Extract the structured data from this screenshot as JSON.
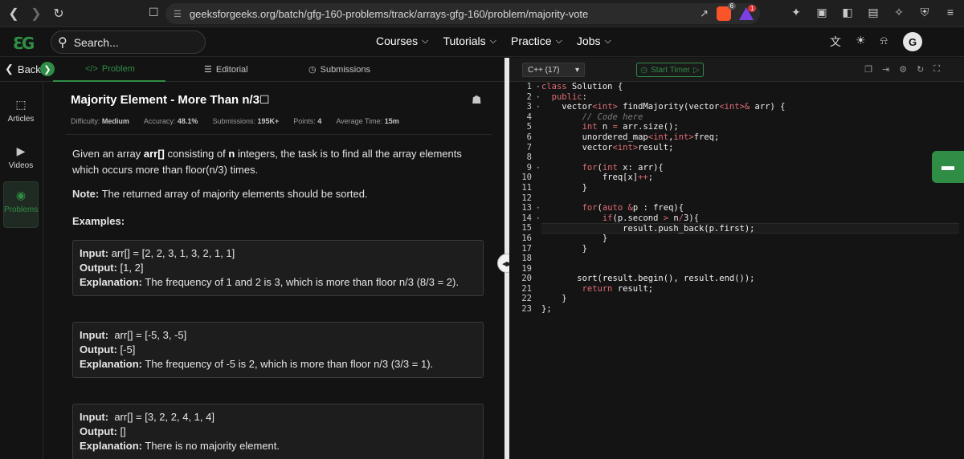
{
  "browser": {
    "url": "geeksforgeeks.org/batch/gfg-160-problems/track/arrays-gfg-160/problem/majority-vote",
    "brave_count": "6",
    "rewards_count": "1"
  },
  "header": {
    "search_placeholder": "Search...",
    "nav": [
      "Courses",
      "Tutorials",
      "Practice",
      "Jobs"
    ],
    "avatar_letter": "G"
  },
  "tabs": {
    "back": "Back",
    "problem": "Problem",
    "editorial": "Editorial",
    "submissions": "Submissions"
  },
  "sidebar": {
    "items": [
      "Articles",
      "Videos",
      "Problems"
    ]
  },
  "problem": {
    "title": "Majority Element - More Than n/3",
    "meta": {
      "difficulty_label": "Difficulty:",
      "difficulty": "Medium",
      "accuracy_label": "Accuracy:",
      "accuracy": "48.1%",
      "submissions_label": "Submissions:",
      "submissions": "195K+",
      "points_label": "Points:",
      "points": "4",
      "avg_time_label": "Average Time:",
      "avg_time": "15m"
    },
    "desc_pre": "Given an array ",
    "desc_arr": "arr[]",
    "desc_mid": " consisting of ",
    "desc_n": "n",
    "desc_post": " integers, the task is to find all the array elements which occurs more than floor(n/3) times.",
    "note_label": "Note:",
    "note_text": " The returned array of majority elements should be sorted.",
    "examples_heading": "Examples:",
    "examples": [
      {
        "input_label": "Input:",
        "input": " arr[] = [2, 2, 3, 1, 3, 2, 1, 1]",
        "output_label": "Output:",
        "output": " [1, 2]",
        "explanation_label": "Explanation:",
        "explanation": " The frequency of 1 and 2 is 3, which is more than floor n/3 (8/3 = 2)."
      },
      {
        "input_label": "Input:",
        "input": "  arr[] = [-5, 3, -5]",
        "output_label": "Output:",
        "output": " [-5]",
        "explanation_label": "Explanation:",
        "explanation": " The frequency of -5 is 2, which is more than floor n/3 (3/3 = 1)."
      },
      {
        "input_label": "Input:",
        "input": "  arr[] = [3, 2, 2, 4, 1, 4]",
        "output_label": "Output:",
        "output": " []",
        "explanation_label": "Explanation:",
        "explanation": " There is no majority element."
      }
    ]
  },
  "editor": {
    "language": "C++ (17)",
    "timer_label": "Start Timer",
    "line_numbers": [
      "1",
      "2",
      "3",
      "4",
      "5",
      "6",
      "7",
      "8",
      "9",
      "10",
      "11",
      "12",
      "13",
      "14",
      "15",
      "16",
      "17",
      "18",
      "19",
      "20",
      "21",
      "22",
      "23"
    ]
  }
}
